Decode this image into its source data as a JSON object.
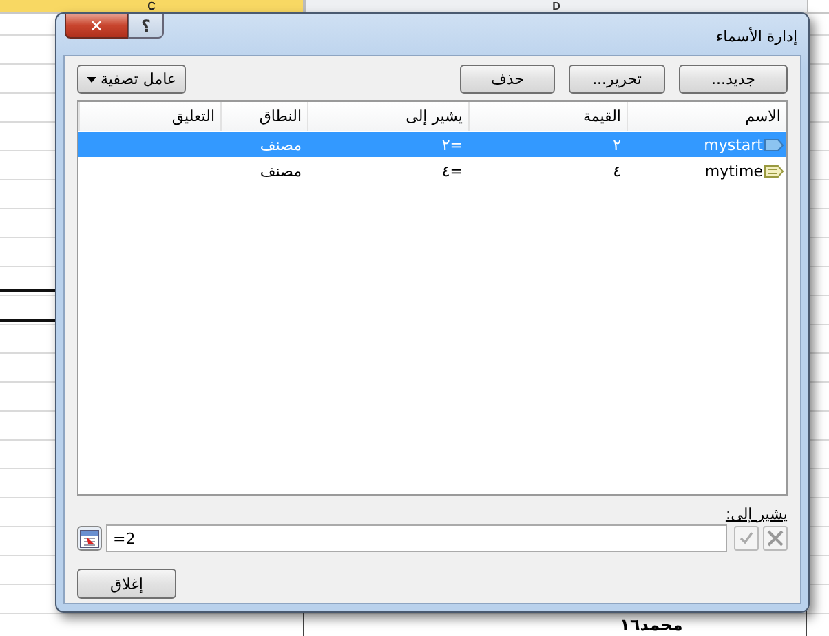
{
  "sheet": {
    "columns": [
      {
        "label": "D",
        "selected": false
      },
      {
        "label": "C",
        "selected": true
      }
    ],
    "cell_text": "محمد١٦"
  },
  "window": {
    "title": "إدارة الأسماء",
    "close": "✕",
    "help": "؟"
  },
  "toolbar": {
    "buttons": [
      "جديد...",
      "تحرير...",
      "حذف"
    ],
    "filter": "عامل تصفية"
  },
  "table": {
    "columns": [
      "الاسم",
      "القيمة",
      "يشير إلى",
      "النطاق",
      "التعليق"
    ],
    "rows": [
      {
        "name": "mystart",
        "value": "٢",
        "refers_to": "=٢",
        "scope": "مصنف",
        "selected": true
      },
      {
        "name": "mytime",
        "value": "٤",
        "refers_to": "=٤",
        "scope": "مصنف",
        "selected": false
      }
    ]
  },
  "refers_to": {
    "label": "يشير إلى:",
    "value": "=2"
  },
  "close_button": "إغلاق"
}
